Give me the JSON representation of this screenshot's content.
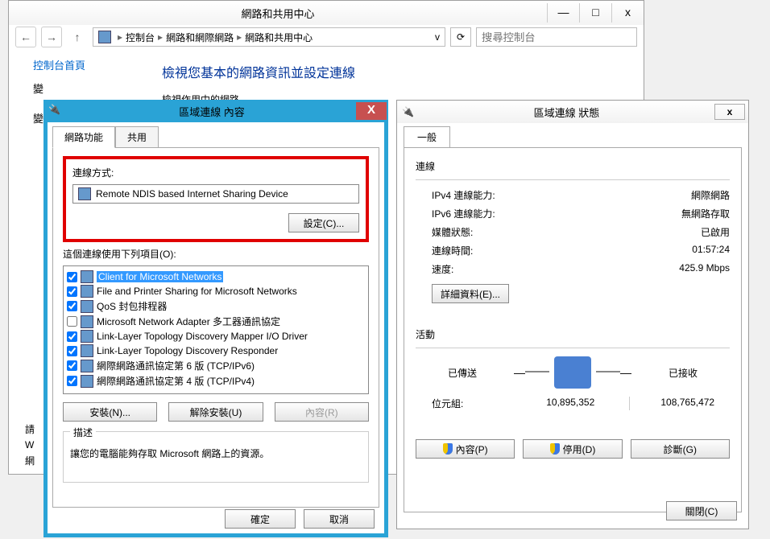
{
  "controlPanel": {
    "title": "網路和共用中心",
    "windowButtons": {
      "min": "—",
      "max": "□",
      "close": "x"
    },
    "nav": {
      "crumb": [
        "控制台",
        "網路和網際網路",
        "網路和共用中心"
      ],
      "searchPlaceholder": "搜尋控制台"
    },
    "left": {
      "home": "控制台首頁",
      "row1": "變",
      "row2": "變"
    },
    "main": {
      "heading": "檢視您基本的網路資訊並設定連線",
      "sub": "檢視作用中的網路"
    },
    "footer": {
      "l1": "請",
      "l2": "W",
      "l3": "網"
    }
  },
  "properties": {
    "title": "區域連線 內容",
    "tabs": {
      "t1": "網路功能",
      "t2": "共用"
    },
    "connectLabel": "連線方式:",
    "adapter": "Remote NDIS based Internet Sharing Device",
    "configure": "設定(C)...",
    "itemsLabel": "這個連線使用下列項目(O):",
    "items": [
      {
        "checked": true,
        "label": "Client for Microsoft Networks",
        "selected": true
      },
      {
        "checked": true,
        "label": "File and Printer Sharing for Microsoft Networks"
      },
      {
        "checked": true,
        "label": "QoS 封包排程器"
      },
      {
        "checked": false,
        "label": "Microsoft Network Adapter 多工器通訊協定"
      },
      {
        "checked": true,
        "label": "Link-Layer Topology Discovery Mapper I/O Driver"
      },
      {
        "checked": true,
        "label": "Link-Layer Topology Discovery Responder"
      },
      {
        "checked": true,
        "label": "網際網路通訊協定第 6 版 (TCP/IPv6)"
      },
      {
        "checked": true,
        "label": "網際網路通訊協定第 4 版 (TCP/IPv4)"
      }
    ],
    "buttons": {
      "install": "安裝(N)...",
      "uninstall": "解除安裝(U)",
      "props": "內容(R)"
    },
    "descLabel": "描述",
    "descText": "讓您的電腦能夠存取 Microsoft 網路上的資源。",
    "ok": "確定",
    "cancel": "取消"
  },
  "status": {
    "title": "區域連線 狀態",
    "tab": "一般",
    "connHeader": "連線",
    "kv": {
      "ipv4k": "IPv4 連線能力:",
      "ipv4v": "網際網路",
      "ipv6k": "IPv6 連線能力:",
      "ipv6v": "無網路存取",
      "mediak": "媒體狀態:",
      "mediav": "已啟用",
      "durk": "連線時間:",
      "durv": "01:57:24",
      "speedk": "速度:",
      "speedv": "425.9 Mbps"
    },
    "details": "詳細資料(E)...",
    "activityHeader": "活動",
    "sent": "已傳送",
    "recv": "已接收",
    "bytesLabel": "位元組:",
    "bytesSent": "10,895,352",
    "bytesRecv": "108,765,472",
    "btns": {
      "props": "內容(P)",
      "disable": "停用(D)",
      "diag": "診斷(G)"
    },
    "close": "關閉(C)"
  }
}
